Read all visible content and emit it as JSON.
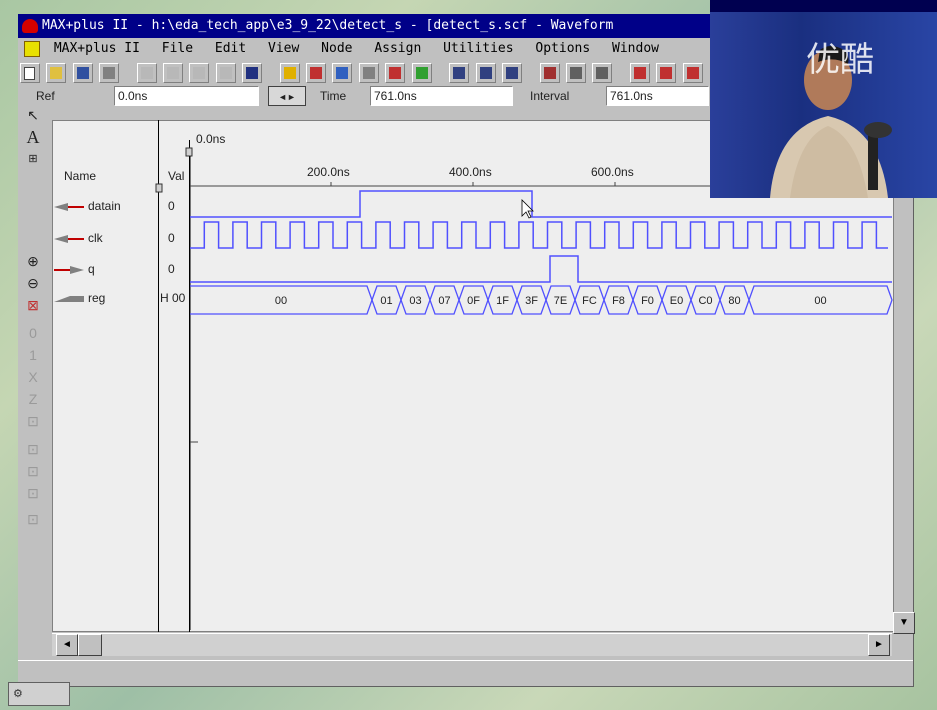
{
  "window": {
    "title": "MAX+plus II - h:\\eda_tech_app\\e3_9_22\\detect_s - [detect_s.scf - Waveform",
    "menu": [
      "MAX+plus II",
      "File",
      "Edit",
      "View",
      "Node",
      "Assign",
      "Utilities",
      "Options",
      "Window"
    ]
  },
  "refbar": {
    "ref_label": "Ref",
    "ref_value": "0.0ns",
    "time_label": "Time",
    "time_value": "761.0ns",
    "interval_label": "Interval",
    "interval_value": "761.0ns"
  },
  "columns": {
    "name": "Name",
    "value": "Val"
  },
  "ruler": {
    "cursor_label": "0.0ns",
    "ticks": [
      "200.0ns",
      "400.0ns",
      "600.0ns"
    ]
  },
  "signals": [
    {
      "name": "datain",
      "value": "0"
    },
    {
      "name": "clk",
      "value": "0"
    },
    {
      "name": "q",
      "value": "0"
    },
    {
      "name": "reg",
      "value": "H 00"
    }
  ],
  "reg_values": [
    "00",
    "01",
    "03",
    "07",
    "0F",
    "1F",
    "3F",
    "7E",
    "FC",
    "F8",
    "F0",
    "E0",
    "C0",
    "80",
    "00"
  ],
  "video": {
    "watermark": "优酷"
  },
  "colors": {
    "title_bg": "#000088",
    "waveform_line": "#5050ff",
    "window_bg": "#c0c0c0"
  }
}
